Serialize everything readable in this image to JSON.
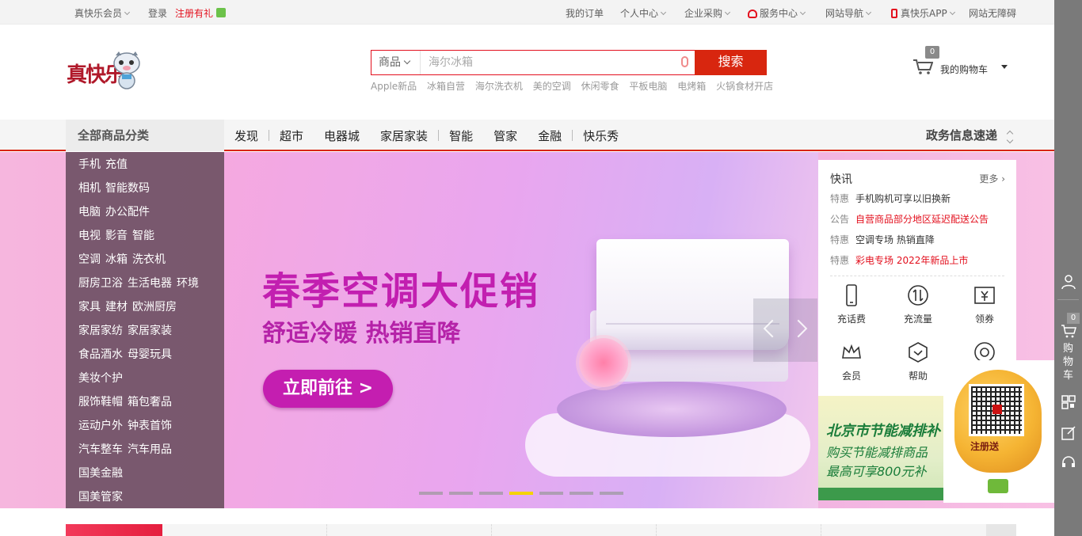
{
  "topbar": {
    "member": "真快乐会员",
    "login": "登录",
    "register": "注册有礼",
    "orders": "我的订单",
    "personal": "个人中心",
    "enterprise": "企业采购",
    "service": "服务中心",
    "sitenav": "网站导航",
    "app": "真快乐APP",
    "accessibility": "网站无障碍"
  },
  "logo": {
    "text": "真快乐"
  },
  "search": {
    "category": "商品",
    "placeholder": "海尔冰箱",
    "button": "搜索",
    "hotwords": [
      "Apple新品",
      "冰箱自营",
      "海尔洗衣机",
      "美的空调",
      "休闲零食",
      "平板电脑",
      "电烤箱",
      "火锅食材开店"
    ]
  },
  "cart": {
    "count": "0",
    "label": "我的购物车"
  },
  "nav": {
    "all_categories": "全部商品分类",
    "items": [
      "发现",
      "超市",
      "电器城",
      "家居家装",
      "智能",
      "管家",
      "金融",
      "快乐秀"
    ],
    "gov": "政务信息速递"
  },
  "categories": [
    [
      "手机",
      "充值"
    ],
    [
      "相机",
      "智能数码"
    ],
    [
      "电脑",
      "办公配件"
    ],
    [
      "电视",
      "影音",
      "智能"
    ],
    [
      "空调",
      "冰箱",
      "洗衣机"
    ],
    [
      "厨房卫浴",
      "生活电器",
      "环境"
    ],
    [
      "家具",
      "建材",
      "欧洲厨房"
    ],
    [
      "家居家纺",
      "家居家装"
    ],
    [
      "食品酒水",
      "母婴玩具"
    ],
    [
      "美妆个护"
    ],
    [
      "服饰鞋帽",
      "箱包奢品"
    ],
    [
      "运动户外",
      "钟表首饰"
    ],
    [
      "汽车整车",
      "汽车用品"
    ],
    [
      "国美金融"
    ],
    [
      "国美管家"
    ]
  ],
  "banner": {
    "headline": "春季空调大促销",
    "subline": "舒适冷暖  热销直降",
    "cta": "立即前往 >",
    "slide_count": 7,
    "active_slide": 4
  },
  "news": {
    "title": "快讯",
    "more": "更多",
    "items": [
      {
        "tag": "特惠",
        "text": "手机购机可享以旧换新",
        "highlight": false
      },
      {
        "tag": "公告",
        "text": "自营商品部分地区延迟配送公告",
        "highlight": true
      },
      {
        "tag": "特惠",
        "text": "空调专场 热销直降",
        "highlight": false
      },
      {
        "tag": "特惠",
        "text": "彩电专场 2022年新品上市",
        "highlight": true
      }
    ],
    "services": [
      "充话费",
      "充流量",
      "领券",
      "会员",
      "帮助"
    ]
  },
  "energy": {
    "line1": "北京市节能减排补",
    "line2": "购买节能减排商品",
    "line3": "最高可享800元补"
  },
  "qr": {
    "label": "注册送"
  },
  "rightbar": {
    "cart_count": "0",
    "cart_label": "购物车"
  },
  "colors": {
    "brand_red": "#d8260f",
    "accent_red": "#e3101e",
    "banner_pink": "#f2a6d8",
    "menu_bg": "#6e5064"
  }
}
